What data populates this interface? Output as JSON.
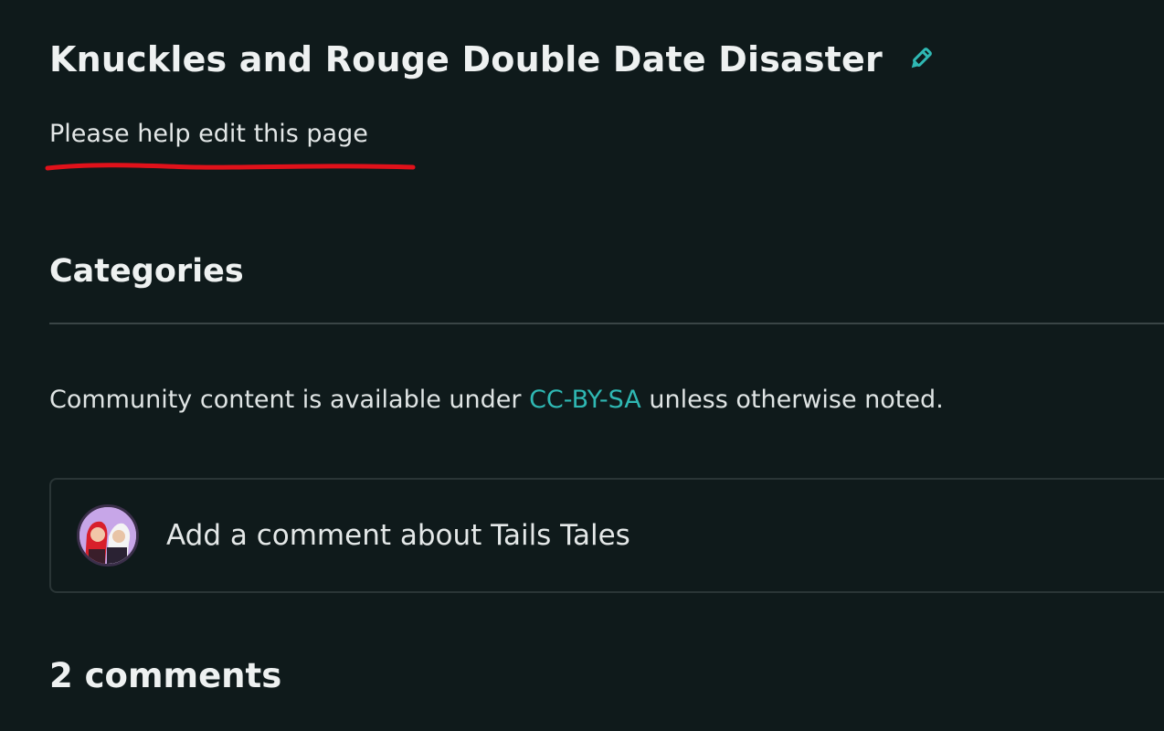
{
  "page": {
    "title": "Knuckles and Rouge Double Date Disaster",
    "help_text": "Please help edit this page"
  },
  "categories": {
    "heading": "Categories"
  },
  "license": {
    "prefix": "Community content is available under ",
    "link": "CC-BY-SA",
    "suffix": " unless otherwise noted."
  },
  "comment_box": {
    "placeholder": "Add a comment about Tails Tales"
  },
  "comments": {
    "count_label": "2 comments"
  },
  "colors": {
    "background": "#0f1a1b",
    "accent": "#2fb8b3",
    "annotation": "#e0111a"
  },
  "icons": {
    "edit": "pencil-icon",
    "avatar": "user-avatar"
  }
}
